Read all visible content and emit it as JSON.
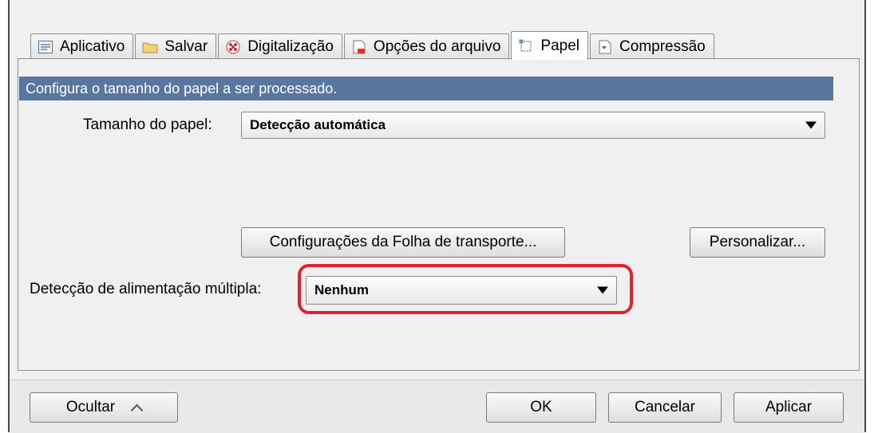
{
  "tabs": [
    {
      "label": "Aplicativo",
      "icon": "app-list-icon"
    },
    {
      "label": "Salvar",
      "icon": "folder-icon"
    },
    {
      "label": "Digitalização",
      "icon": "scan-pattern-icon"
    },
    {
      "label": "Opções do arquivo",
      "icon": "file-options-icon"
    },
    {
      "label": "Papel",
      "icon": "paper-icon",
      "active": true
    },
    {
      "label": "Compressão",
      "icon": "compression-icon"
    }
  ],
  "description": "Configura o tamanho do papel a ser processado.",
  "paper_size": {
    "label": "Tamanho do papel:",
    "value": "Detecção automática"
  },
  "carrier_sheet_button": "Configurações da Folha de transporte...",
  "customize_button": "Personalizar...",
  "multifeed": {
    "label": "Detecção de alimentação múltipla:",
    "value": "Nenhum"
  },
  "footer": {
    "hide": "Ocultar",
    "ok": "OK",
    "cancel": "Cancelar",
    "apply": "Aplicar"
  },
  "colors": {
    "header_band": "#5876a0",
    "highlight": "#e0222f"
  }
}
